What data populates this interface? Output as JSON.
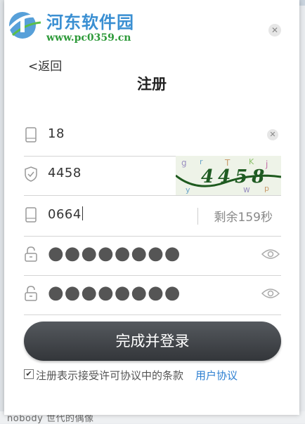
{
  "background": {
    "bottom_text": "nobody 世代的偶像"
  },
  "watermark": {
    "title": "河东软件园",
    "url": "www.pc0359.cn"
  },
  "dialog": {
    "close_icon": "close-icon",
    "back_label": "<返回",
    "title": "注册"
  },
  "fields": {
    "phone": {
      "value": "18",
      "icon": "phone-icon",
      "clear_icon": "clear-icon"
    },
    "captcha": {
      "value": "4458",
      "icon": "shield-icon",
      "image_text": "4458"
    },
    "sms": {
      "value": "0664",
      "icon": "phone-icon",
      "countdown": "剩余159秒"
    },
    "password": {
      "value": "●●●●●●●●",
      "icon": "lock-icon",
      "toggle_icon": "eye-icon"
    },
    "confirm_password": {
      "value": "●●●●●●●●",
      "icon": "lock-icon",
      "toggle_icon": "eye-icon"
    }
  },
  "submit_label": "完成并登录",
  "agreement": {
    "checked": true,
    "check_mark": "✔",
    "text": "注册表示接受许可协议中的条款",
    "link": "用户协议"
  },
  "colors": {
    "link": "#2d7fd1",
    "button": "#3c3f44",
    "watermark_blue": "#3a8fd2",
    "watermark_green": "#2e9a3a"
  }
}
